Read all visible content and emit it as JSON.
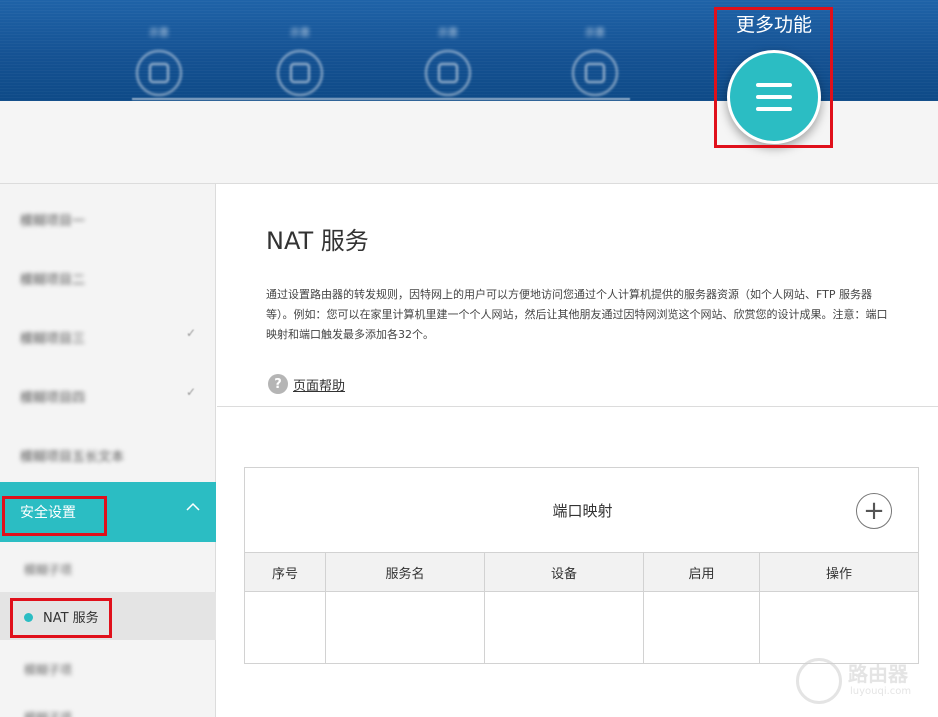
{
  "header": {
    "nav_items": [
      "示意",
      "示意",
      "示意",
      "示意"
    ],
    "more_label": "更多功能"
  },
  "sidebar": {
    "items": [
      {
        "label": "模糊项目一",
        "has_chevron": false
      },
      {
        "label": "模糊项目二",
        "has_chevron": false
      },
      {
        "label": "模糊项目三",
        "has_chevron": true
      },
      {
        "label": "模糊项目四",
        "has_chevron": true
      },
      {
        "label": "模糊项目五长文本",
        "has_chevron": false
      }
    ],
    "active_section": "安全设置",
    "sub_items": [
      "模糊子项",
      "NAT 服务",
      "模糊子项",
      "模糊子项"
    ],
    "active_sub_item": "NAT 服务"
  },
  "main": {
    "title": "NAT 服务",
    "description": "通过设置路由器的转发规则，因特网上的用户可以方便地访问您通过个人计算机提供的服务器资源（如个人网站、FTP 服务器等）。例如：您可以在家里计算机里建一个个人网站，然后让其他朋友通过因特网浏览这个网站、欣赏您的设计成果。注意：端口映射和端口触发最多添加各32个。",
    "help_icon": "?",
    "help_link": "页面帮助"
  },
  "table": {
    "title": "端口映射",
    "add_icon": "+",
    "columns": [
      "序号",
      "服务名",
      "设备",
      "启用",
      "操作"
    ],
    "rows": []
  },
  "watermark": {
    "text": "路由器",
    "sub": "luyouqi.com"
  },
  "colors": {
    "header_blue": "#155293",
    "accent_teal": "#2bbdc3",
    "highlight_red": "#e0101b"
  }
}
